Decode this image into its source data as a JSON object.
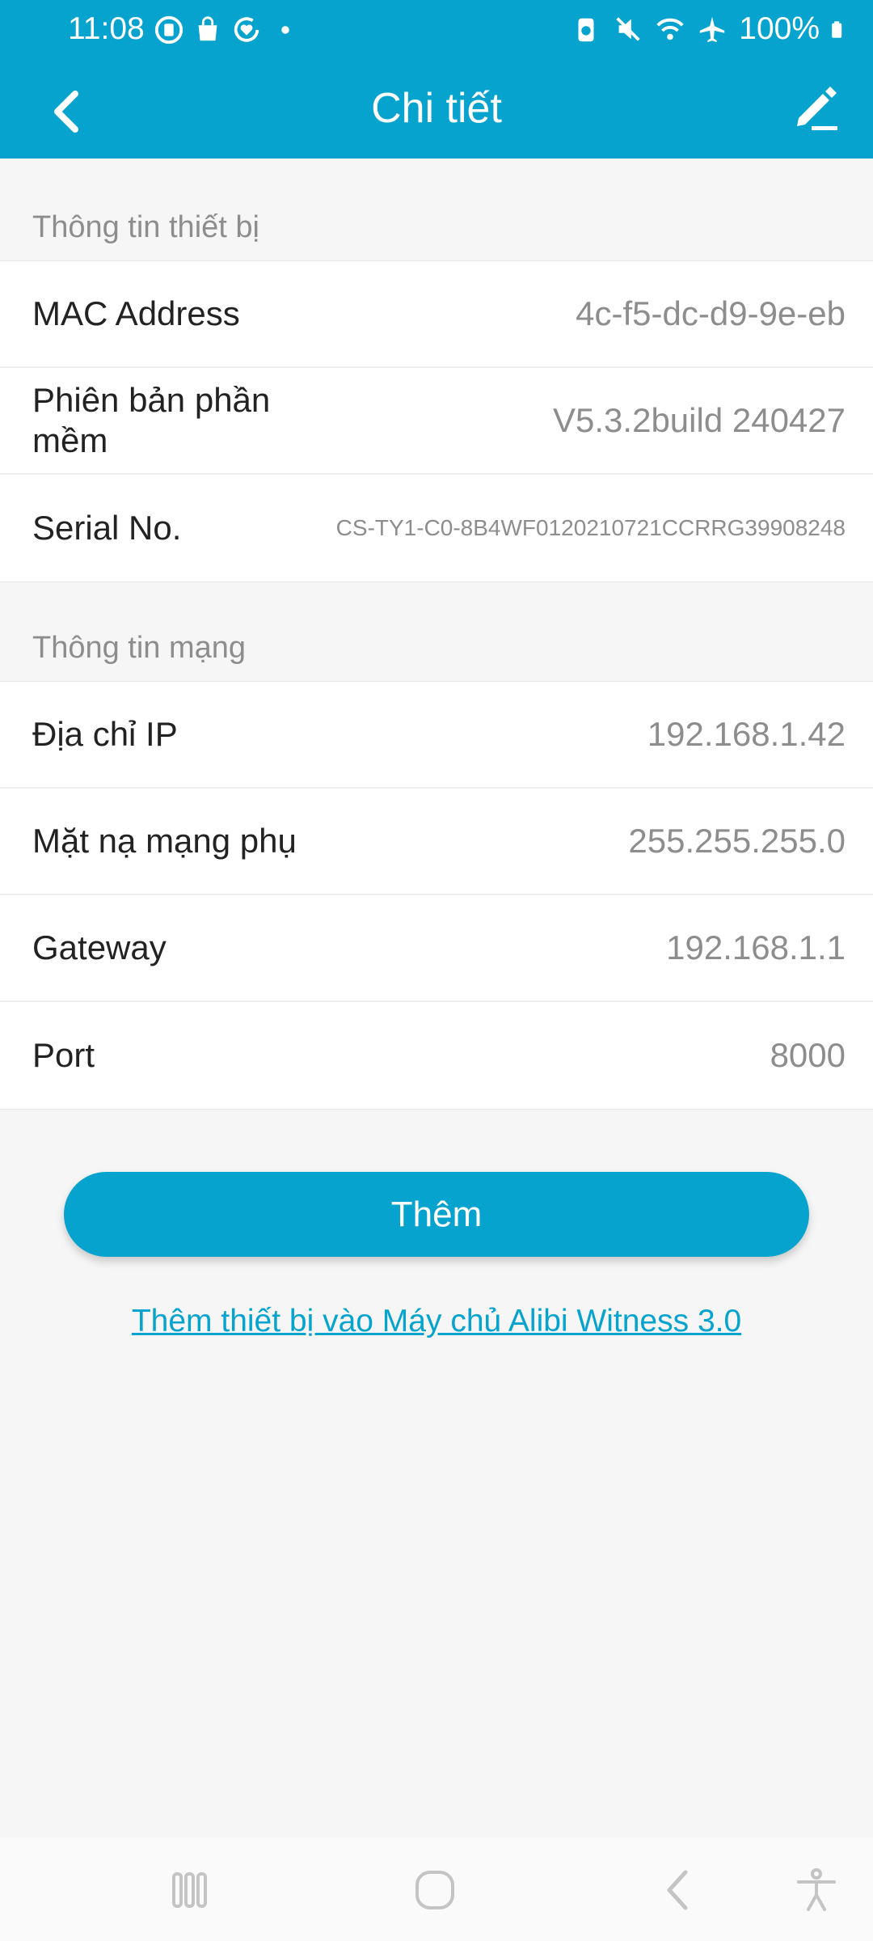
{
  "status_bar": {
    "time": "11:08",
    "battery": "100%",
    "left_icons": [
      "stop-icon",
      "bag-icon",
      "heart-sync-icon",
      "dot-icon"
    ],
    "right_icons": [
      "battery-saver-icon",
      "mute-icon",
      "wifi-icon",
      "airplane-icon",
      "battery-icon"
    ]
  },
  "header": {
    "title": "Chi tiết",
    "back_icon": "chevron-left-icon",
    "edit_icon": "pencil-icon"
  },
  "device_info": {
    "section_title": "Thông tin thiết bị",
    "rows": [
      {
        "label": "MAC Address",
        "value": "4c-f5-dc-d9-9e-eb"
      },
      {
        "label": "Phiên bản phần mềm",
        "value": "V5.3.2build 240427"
      },
      {
        "label": "Serial No.",
        "value": "CS-TY1-C0-8B4WF0120210721CCRRG39908248"
      }
    ]
  },
  "network_info": {
    "section_title": "Thông tin mạng",
    "rows": [
      {
        "label": "Địa chỉ IP",
        "value": "192.168.1.42"
      },
      {
        "label": "Mặt nạ mạng phụ",
        "value": "255.255.255.0"
      },
      {
        "label": "Gateway",
        "value": "192.168.1.1"
      },
      {
        "label": "Port",
        "value": "8000"
      }
    ]
  },
  "actions": {
    "add_label": "Thêm",
    "link_label": "Thêm thiết bị vào Máy chủ Alibi Witness 3.0"
  },
  "colors": {
    "accent": "#07a3cf",
    "background": "#f6f6f6",
    "secondary_text": "#8d8d8d"
  }
}
